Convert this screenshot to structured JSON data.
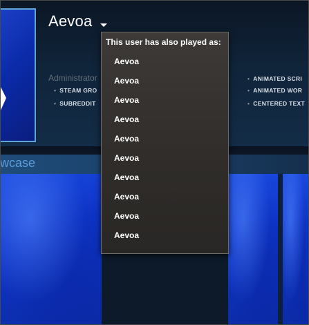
{
  "profile": {
    "persona_name": "Aevoa",
    "role_label": "Administrator",
    "left_tags": [
      "STEAM GRO",
      "SUBREDDIT"
    ],
    "right_tags": [
      "ANIMATED SCRI",
      "ANIMATED WOR",
      "CENTERED TEXT"
    ]
  },
  "showcase": {
    "title": "wcase"
  },
  "alias_dropdown": {
    "header": "This user has also played as:",
    "items": [
      "Aevoa",
      "Aevoa",
      "Aevoa",
      "Aevoa",
      "Aevoa",
      "Aevoa",
      "Aevoa",
      "Aevoa",
      "Aevoa",
      "Aevoa"
    ]
  }
}
